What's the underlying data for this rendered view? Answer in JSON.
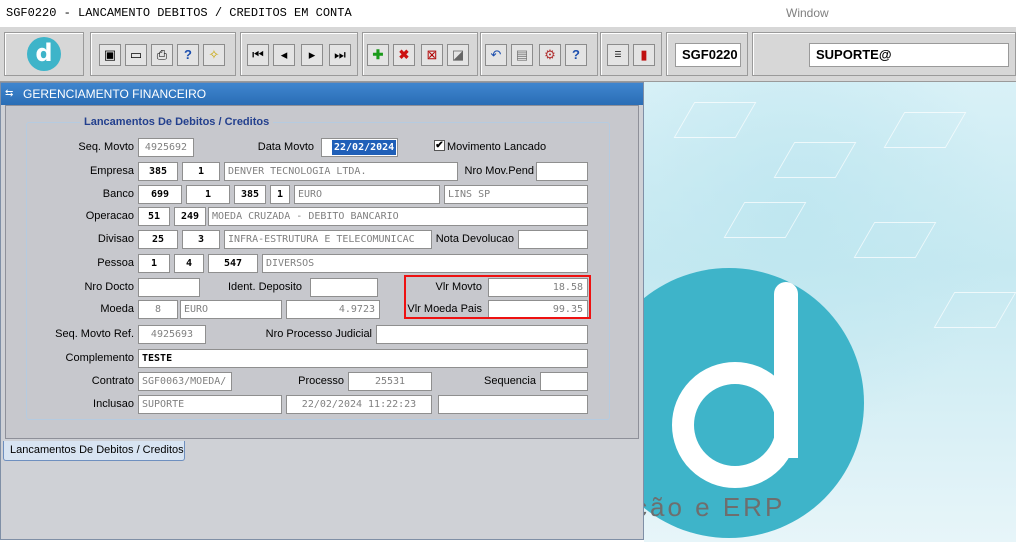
{
  "titlebar": {
    "app_title": "SGF0220 - LANCAMENTO DEBITOS / CREDITOS EM CONTA",
    "window_menu": "Window"
  },
  "toolbar": {
    "icons": [
      "logo-icon",
      "save-icon",
      "print-preview-icon",
      "print-icon",
      "help-query-icon",
      "magic-icon",
      "first-record-icon",
      "prev-record-icon",
      "next-record-icon",
      "last-record-icon",
      "insert-record-icon",
      "delete-record-icon",
      "clear-icon",
      "eraser-icon",
      "undo-icon",
      "clipboard-icon",
      "tools-icon",
      "help-icon",
      "menu-icon",
      "exit-icon"
    ],
    "module_code": "SGF0220",
    "user": "SUPORTE@"
  },
  "window": {
    "title": "GERENCIAMENTO FINANCEIRO"
  },
  "form": {
    "section_title": "Lancamentos De Debitos / Creditos",
    "seq_movto": {
      "label": "Seq. Movto",
      "value": "4925692"
    },
    "data_movto": {
      "label": "Data Movto",
      "value": "22/02/2024"
    },
    "movimento_lancado": {
      "label": "Movimento Lancado",
      "checked": "✔"
    },
    "empresa": {
      "label": "Empresa",
      "code": "385",
      "sub": "1",
      "name": "DENVER TECNOLOGIA LTDA."
    },
    "nro_mov_pend": {
      "label": "Nro Mov.Pend",
      "value": ""
    },
    "banco": {
      "label": "Banco",
      "code": "699",
      "agencia": "1",
      "conta": "385",
      "digito": "1",
      "name": "EURO",
      "city": "LINS SP"
    },
    "operacao": {
      "label": "Operacao",
      "code": "51",
      "sub": "249",
      "name": "MOEDA CRUZADA - DEBITO BANCARIO"
    },
    "divisao": {
      "label": "Divisao",
      "code": "25",
      "sub": "3",
      "name": "INFRA-ESTRUTURA E TELECOMUNICAC"
    },
    "nota_devolucao": {
      "label": "Nota Devolucao",
      "value": ""
    },
    "pessoa": {
      "label": "Pessoa",
      "a": "1",
      "b": "4",
      "c": "547",
      "name": "DIVERSOS"
    },
    "nro_docto": {
      "label": "Nro Docto",
      "value": ""
    },
    "ident_deposito": {
      "label": "Ident. Deposito",
      "value": ""
    },
    "vlr_movto": {
      "label": "Vlr Movto",
      "value": "18.58"
    },
    "moeda": {
      "label": "Moeda",
      "code": "8",
      "name": "EURO",
      "rate": "4.9723"
    },
    "vlr_moeda_pais": {
      "label": "Vlr Moeda Pais",
      "value": "99.35"
    },
    "seq_movto_ref": {
      "label": "Seq. Movto Ref.",
      "value": "4925693"
    },
    "nro_processo_judicial": {
      "label": "Nro Processo Judicial",
      "value": ""
    },
    "complemento": {
      "label": "Complemento",
      "value": "TESTE"
    },
    "contrato": {
      "label": "Contrato",
      "value": "SGF0063/MOEDA/"
    },
    "processo": {
      "label": "Processo",
      "value": "25531"
    },
    "sequencia": {
      "label": "Sequencia",
      "value": ""
    },
    "inclusao": {
      "label": "Inclusao",
      "user": "SUPORTE",
      "datetime": "22/02/2024 11:22:23",
      "extra": ""
    }
  },
  "tabs": [
    {
      "label": "Lancamentos De Debitos / Creditos"
    }
  ],
  "background": {
    "tagline": "ção e ERP"
  },
  "colors": {
    "accent": "#2a6db5",
    "highlight": "#e11111",
    "section_title": "#23408e",
    "logo": "#3eb4c9"
  }
}
